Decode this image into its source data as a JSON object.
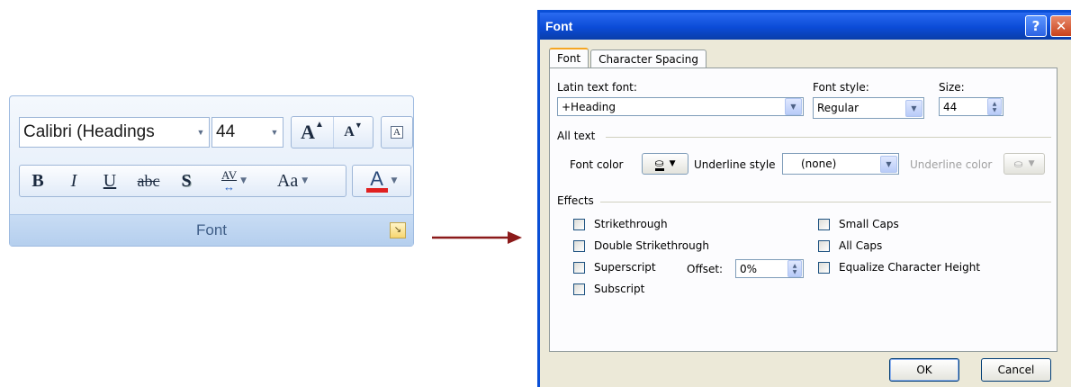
{
  "ribbon": {
    "font_name": "Calibri (Headings",
    "font_size": "44",
    "grow_glyph": "A",
    "shrink_glyph": "A",
    "clear_glyph": "A",
    "bold": "B",
    "italic": "I",
    "underline": "U",
    "strike": "abc",
    "shadow": "S",
    "spacing": "AV",
    "change_case": "Aa",
    "font_color": "A",
    "group_label": "Font"
  },
  "dialog": {
    "title": "Font",
    "help": "?",
    "close": "✕",
    "tabs": [
      {
        "label": "Font",
        "active": true
      },
      {
        "label": "Character Spacing",
        "active": false
      }
    ],
    "latin_font_label": "Latin text font:",
    "latin_font_value": "+Heading",
    "font_style_label": "Font style:",
    "font_style_value": "Regular",
    "size_label": "Size:",
    "size_value": "44",
    "all_text_label": "All text",
    "font_color_label": "Font color",
    "underline_style_label": "Underline style",
    "underline_style_value": "(none)",
    "underline_color_label": "Underline color",
    "effects_label": "Effects",
    "effects_left": [
      {
        "label": "Strikethrough",
        "checked": false
      },
      {
        "label": "Double Strikethrough",
        "checked": false
      },
      {
        "label": "Superscript",
        "checked": false
      },
      {
        "label": "Subscript",
        "checked": false
      }
    ],
    "effects_right": [
      {
        "label": "Small Caps",
        "checked": false
      },
      {
        "label": "All Caps",
        "checked": false
      },
      {
        "label": "Equalize Character Height",
        "checked": false
      }
    ],
    "offset_label": "Offset:",
    "offset_value": "0%",
    "ok_label": "OK",
    "cancel_label": "Cancel"
  },
  "colors": {
    "title_bar": "#0b4bd7",
    "dialog_bg": "#ece9d8",
    "ribbon_bg": "#dde9f8",
    "font_color_swatch": "#e02020",
    "arrow": "#8b1a1a"
  }
}
